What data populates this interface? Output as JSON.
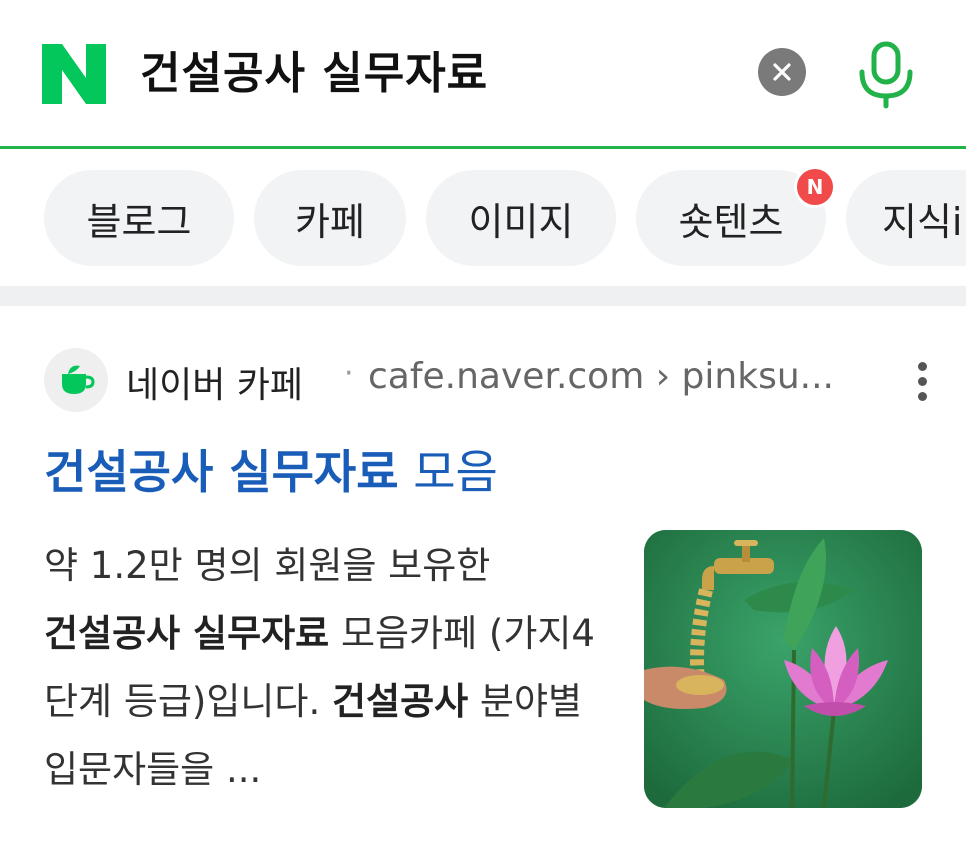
{
  "search": {
    "logo_letter": "N",
    "query": "건설공사 실무자료",
    "clear_icon": "close-icon",
    "mic_icon": "microphone-icon"
  },
  "tabs": [
    {
      "label": "블로그"
    },
    {
      "label": "카페"
    },
    {
      "label": "이미지"
    },
    {
      "label": "숏텐츠",
      "badge": "N"
    },
    {
      "label": "지식iN"
    }
  ],
  "result": {
    "source_name": "네이버 카페",
    "source_url": "cafe.naver.com › pinksu...",
    "title_bold": "건설공사 실무자료",
    "title_rest": " 모음",
    "snippet": {
      "part1": "약 1.2만 명의 회원을 보유한",
      "bold1": "건설공사 실무자료",
      "part2": " 모음카페 (가지4단계 등급)입니다. ",
      "bold2": "건설공사",
      "part3": " 분야별 입문자들을 ..."
    }
  },
  "colors": {
    "brand_green": "#03c75a",
    "underline_green": "#21b24a",
    "link_blue": "#1a5db8",
    "badge_red": "#f04a4a"
  }
}
